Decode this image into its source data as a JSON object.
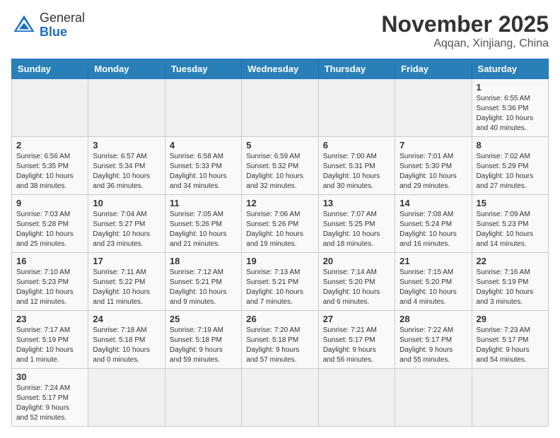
{
  "header": {
    "logo_general": "General",
    "logo_blue": "Blue",
    "month": "November 2025",
    "location": "Aqqan, Xinjiang, China"
  },
  "weekdays": [
    "Sunday",
    "Monday",
    "Tuesday",
    "Wednesday",
    "Thursday",
    "Friday",
    "Saturday"
  ],
  "days": [
    {
      "num": "",
      "info": ""
    },
    {
      "num": "",
      "info": ""
    },
    {
      "num": "",
      "info": ""
    },
    {
      "num": "",
      "info": ""
    },
    {
      "num": "",
      "info": ""
    },
    {
      "num": "",
      "info": ""
    },
    {
      "num": "1",
      "info": "Sunrise: 6:55 AM\nSunset: 5:36 PM\nDaylight: 10 hours\nand 40 minutes."
    },
    {
      "num": "2",
      "info": "Sunrise: 6:56 AM\nSunset: 5:35 PM\nDaylight: 10 hours\nand 38 minutes."
    },
    {
      "num": "3",
      "info": "Sunrise: 6:57 AM\nSunset: 5:34 PM\nDaylight: 10 hours\nand 36 minutes."
    },
    {
      "num": "4",
      "info": "Sunrise: 6:58 AM\nSunset: 5:33 PM\nDaylight: 10 hours\nand 34 minutes."
    },
    {
      "num": "5",
      "info": "Sunrise: 6:59 AM\nSunset: 5:32 PM\nDaylight: 10 hours\nand 32 minutes."
    },
    {
      "num": "6",
      "info": "Sunrise: 7:00 AM\nSunset: 5:31 PM\nDaylight: 10 hours\nand 30 minutes."
    },
    {
      "num": "7",
      "info": "Sunrise: 7:01 AM\nSunset: 5:30 PM\nDaylight: 10 hours\nand 29 minutes."
    },
    {
      "num": "8",
      "info": "Sunrise: 7:02 AM\nSunset: 5:29 PM\nDaylight: 10 hours\nand 27 minutes."
    },
    {
      "num": "9",
      "info": "Sunrise: 7:03 AM\nSunset: 5:28 PM\nDaylight: 10 hours\nand 25 minutes."
    },
    {
      "num": "10",
      "info": "Sunrise: 7:04 AM\nSunset: 5:27 PM\nDaylight: 10 hours\nand 23 minutes."
    },
    {
      "num": "11",
      "info": "Sunrise: 7:05 AM\nSunset: 5:26 PM\nDaylight: 10 hours\nand 21 minutes."
    },
    {
      "num": "12",
      "info": "Sunrise: 7:06 AM\nSunset: 5:26 PM\nDaylight: 10 hours\nand 19 minutes."
    },
    {
      "num": "13",
      "info": "Sunrise: 7:07 AM\nSunset: 5:25 PM\nDaylight: 10 hours\nand 18 minutes."
    },
    {
      "num": "14",
      "info": "Sunrise: 7:08 AM\nSunset: 5:24 PM\nDaylight: 10 hours\nand 16 minutes."
    },
    {
      "num": "15",
      "info": "Sunrise: 7:09 AM\nSunset: 5:23 PM\nDaylight: 10 hours\nand 14 minutes."
    },
    {
      "num": "16",
      "info": "Sunrise: 7:10 AM\nSunset: 5:23 PM\nDaylight: 10 hours\nand 12 minutes."
    },
    {
      "num": "17",
      "info": "Sunrise: 7:11 AM\nSunset: 5:22 PM\nDaylight: 10 hours\nand 11 minutes."
    },
    {
      "num": "18",
      "info": "Sunrise: 7:12 AM\nSunset: 5:21 PM\nDaylight: 10 hours\nand 9 minutes."
    },
    {
      "num": "19",
      "info": "Sunrise: 7:13 AM\nSunset: 5:21 PM\nDaylight: 10 hours\nand 7 minutes."
    },
    {
      "num": "20",
      "info": "Sunrise: 7:14 AM\nSunset: 5:20 PM\nDaylight: 10 hours\nand 6 minutes."
    },
    {
      "num": "21",
      "info": "Sunrise: 7:15 AM\nSunset: 5:20 PM\nDaylight: 10 hours\nand 4 minutes."
    },
    {
      "num": "22",
      "info": "Sunrise: 7:16 AM\nSunset: 5:19 PM\nDaylight: 10 hours\nand 3 minutes."
    },
    {
      "num": "23",
      "info": "Sunrise: 7:17 AM\nSunset: 5:19 PM\nDaylight: 10 hours\nand 1 minute."
    },
    {
      "num": "24",
      "info": "Sunrise: 7:18 AM\nSunset: 5:18 PM\nDaylight: 10 hours\nand 0 minutes."
    },
    {
      "num": "25",
      "info": "Sunrise: 7:19 AM\nSunset: 5:18 PM\nDaylight: 9 hours\nand 59 minutes."
    },
    {
      "num": "26",
      "info": "Sunrise: 7:20 AM\nSunset: 5:18 PM\nDaylight: 9 hours\nand 57 minutes."
    },
    {
      "num": "27",
      "info": "Sunrise: 7:21 AM\nSunset: 5:17 PM\nDaylight: 9 hours\nand 56 minutes."
    },
    {
      "num": "28",
      "info": "Sunrise: 7:22 AM\nSunset: 5:17 PM\nDaylight: 9 hours\nand 55 minutes."
    },
    {
      "num": "29",
      "info": "Sunrise: 7:23 AM\nSunset: 5:17 PM\nDaylight: 9 hours\nand 54 minutes."
    },
    {
      "num": "30",
      "info": "Sunrise: 7:24 AM\nSunset: 5:17 PM\nDaylight: 9 hours\nand 52 minutes."
    },
    {
      "num": "",
      "info": ""
    },
    {
      "num": "",
      "info": ""
    },
    {
      "num": "",
      "info": ""
    },
    {
      "num": "",
      "info": ""
    },
    {
      "num": "",
      "info": ""
    }
  ]
}
